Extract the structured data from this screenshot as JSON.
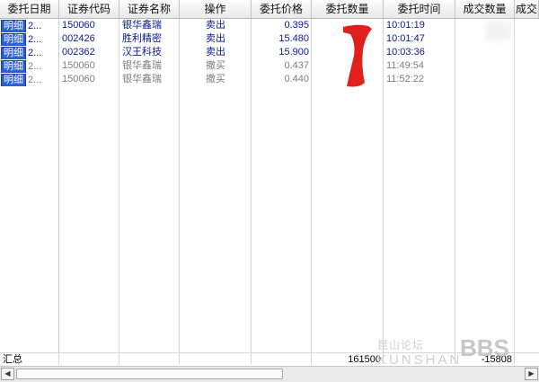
{
  "header": {
    "columns": [
      "委托日期",
      "证券代码",
      "证券名称",
      "操作",
      "委托价格",
      "委托数量",
      "委托时间",
      "成交数量",
      "成交"
    ]
  },
  "rows": [
    {
      "detail": "明细",
      "date": "2...",
      "code": "150060",
      "name": "银华鑫瑞",
      "op": "卖出",
      "price": "0.395",
      "time": "10:01:19",
      "status": "active"
    },
    {
      "detail": "明细",
      "date": "2...",
      "code": "002426",
      "name": "胜利精密",
      "op": "卖出",
      "price": "15.480",
      "time": "10:01:47",
      "status": "active"
    },
    {
      "detail": "明细",
      "date": "2...",
      "code": "002362",
      "name": "汉王科技",
      "op": "卖出",
      "price": "15.900",
      "time": "10:03:36",
      "status": "active"
    },
    {
      "detail": "明细",
      "date": "2...",
      "code": "150060",
      "name": "银华鑫瑞",
      "op": "撤买",
      "price": "0.437",
      "time": "11:49:54",
      "status": "cancelled"
    },
    {
      "detail": "明细",
      "date": "2...",
      "code": "150060",
      "name": "银华鑫瑞",
      "op": "撤买",
      "price": "0.440",
      "time": "11:52:22",
      "status": "cancelled"
    }
  ],
  "summary": {
    "label": "汇总",
    "qty_total": "161500",
    "fill_total": "-15808"
  },
  "watermark": {
    "text1": "昆山论坛",
    "text2": "KUNSHAN",
    "text3": "BBS"
  },
  "colors": {
    "active_text": "#0a1a9a",
    "cancelled_text": "#7e7e7e",
    "detail_button": "#2a5fd6",
    "redaction": "#e0201a"
  },
  "scrollbar": {
    "left_arrow": "◀",
    "right_arrow": "▶"
  }
}
